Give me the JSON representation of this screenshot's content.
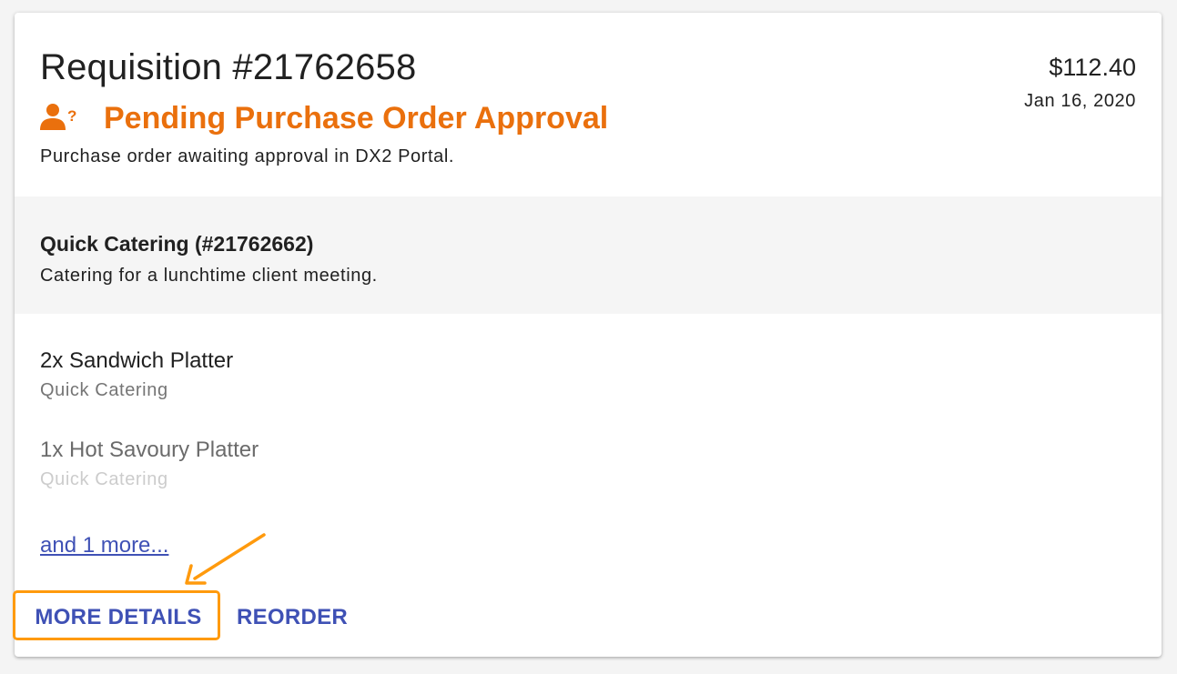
{
  "requisition": {
    "title": "Requisition #21762658",
    "amount": "$112.40",
    "date": "Jan 16, 2020",
    "status": {
      "label": "Pending Purchase Order Approval",
      "description": "Purchase order awaiting approval in DX2 Portal.",
      "icon": "person-question-icon",
      "color": "#ea700d"
    }
  },
  "supplier": {
    "name": "Quick Catering (#21762662)",
    "description": "Catering for a lunchtime client meeting."
  },
  "items": [
    {
      "name": "2x Sandwich Platter",
      "supplier": "Quick Catering"
    },
    {
      "name": "1x Hot Savoury Platter",
      "supplier": "Quick Catering"
    }
  ],
  "more_link": "and 1 more...",
  "actions": {
    "more_details": "MORE DETAILS",
    "reorder": "REORDER"
  },
  "colors": {
    "accent": "#3f51b5",
    "highlight": "#ff9a0d",
    "status": "#ea700d"
  }
}
